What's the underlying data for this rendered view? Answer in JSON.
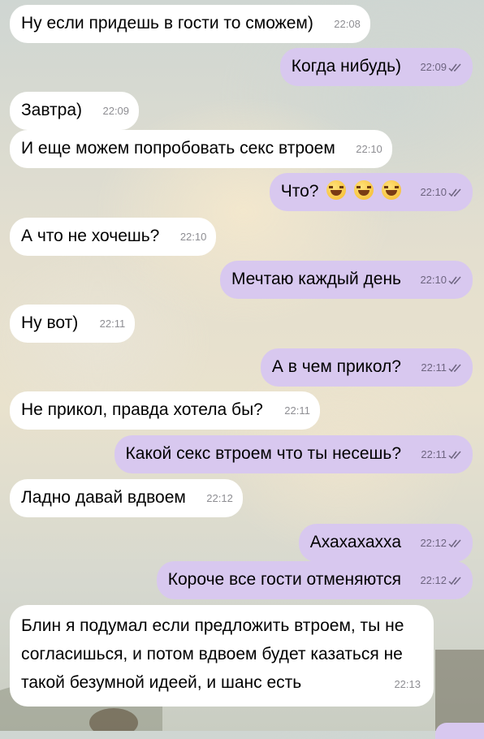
{
  "messages": [
    {
      "dir": "in",
      "text": "Ну если придешь в гости то сможем)",
      "time": "22:08"
    },
    {
      "dir": "out",
      "text": "Когда нибудь)",
      "time": "22:09"
    },
    {
      "dir": "in",
      "text": "Завтра)",
      "time": "22:09"
    },
    {
      "dir": "in",
      "text": "И еще можем попробовать секс втроем",
      "time": "22:10"
    },
    {
      "dir": "out",
      "text": "Что?",
      "time": "22:10",
      "emoji": [
        "face-with-tears-of-joy",
        "face-with-tears-of-joy",
        "face-with-tears-of-joy"
      ]
    },
    {
      "dir": "in",
      "text": "А что не хочешь?",
      "time": "22:10"
    },
    {
      "dir": "out",
      "text": "Мечтаю каждый день",
      "time": "22:10"
    },
    {
      "dir": "in",
      "text": "Ну вот)",
      "time": "22:11"
    },
    {
      "dir": "out",
      "text": "А в чем прикол?",
      "time": "22:11"
    },
    {
      "dir": "in",
      "text": "Не прикол, правда хотела бы?",
      "time": "22:11"
    },
    {
      "dir": "out",
      "text": "Какой секс втроем что ты несешь?",
      "time": "22:11"
    },
    {
      "dir": "in",
      "text": "Ладно давай вдвоем",
      "time": "22:12"
    },
    {
      "dir": "out",
      "text": "Ахахахахха",
      "time": "22:12"
    },
    {
      "dir": "out",
      "text": "Короче все гости отменяются",
      "time": "22:12"
    },
    {
      "dir": "in",
      "text": "Блин я подумал если предложить втроем, ты не согласишься, и потом вдвоем будет казаться не такой безумной идеей, и шанс есть",
      "time": "22:13"
    }
  ],
  "colors": {
    "incoming_bubble": "#ffffff",
    "outgoing_bubble": "#d8c8ef",
    "time_text": "#8e8e93"
  },
  "read_status_icon": "double-check-icon"
}
